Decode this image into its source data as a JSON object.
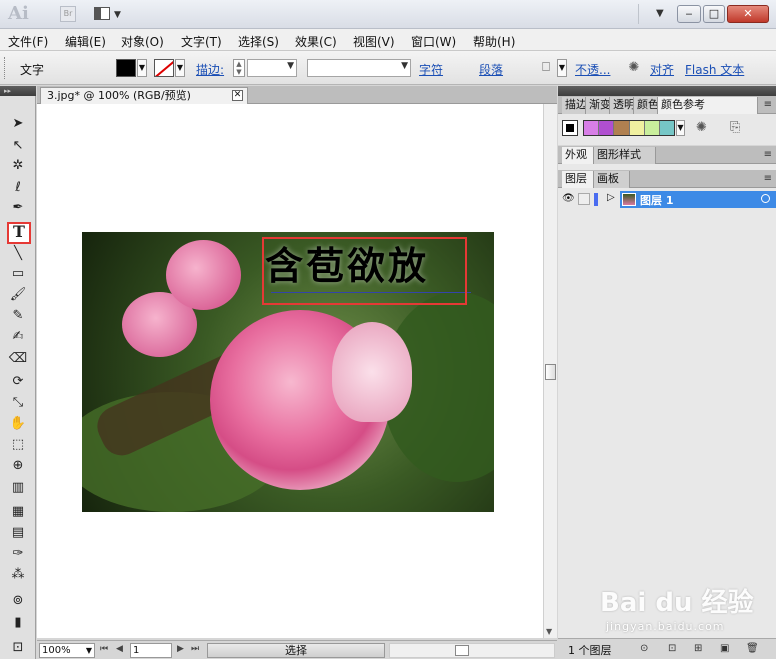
{
  "titlebar": {
    "logo": "Ai",
    "bridge": "Br",
    "window_controls": {
      "minimize": "‒",
      "maximize": "□",
      "close": "✕"
    }
  },
  "menu": [
    "文件(F)",
    "编辑(E)",
    "对象(O)",
    "文字(T)",
    "选择(S)",
    "效果(C)",
    "视图(V)",
    "窗口(W)",
    "帮助(H)"
  ],
  "control": {
    "mode_label": "文字",
    "stroke_label": "描边:",
    "char_link": "字符",
    "para_link": "段落",
    "opacity_link": "不透...",
    "align_link": "对齐",
    "flash_link": "Flash 文本"
  },
  "document": {
    "tab_title": "3.jpg* @ 100% (RGB/预览)",
    "headline_text": "含苞欲放"
  },
  "status": {
    "zoom": "100%",
    "page": "1",
    "tool_text": "选择"
  },
  "right_panels": {
    "top_tabs": [
      "描边",
      "渐变",
      "透明",
      "颜色",
      "颜色参考"
    ],
    "color_group": [
      "#d77ee6",
      "#b04fd0",
      "#b08050",
      "#f0f0a0",
      "#c9ee9c",
      "#76c6c6"
    ],
    "mid_tabs": [
      "外观",
      "图形样式"
    ],
    "layer_tabs": [
      "图层",
      "画板"
    ],
    "layer_name": "图层 1",
    "layers_count": "1 个图层"
  },
  "watermark": {
    "brand": "Bai du 经验",
    "url": "jingyan.baidu.com"
  },
  "colors": {
    "highlight": "#e53935",
    "selection": "#3d8ae6",
    "link": "#1b4fb5"
  }
}
